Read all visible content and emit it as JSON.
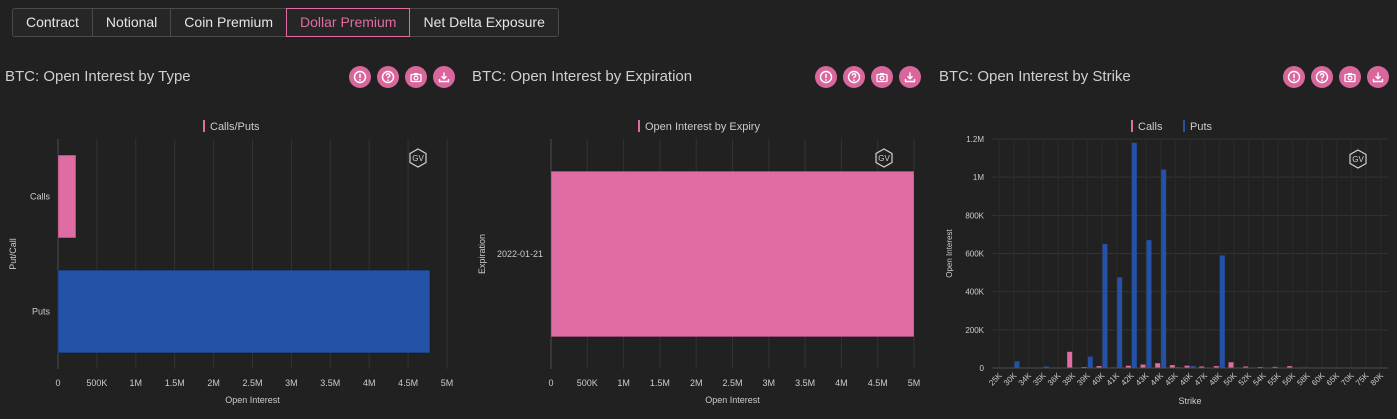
{
  "tabs": [
    {
      "label": "Contract"
    },
    {
      "label": "Notional"
    },
    {
      "label": "Coin Premium"
    },
    {
      "label": "Dollar Premium",
      "active": true
    },
    {
      "label": "Net Delta Exposure"
    }
  ],
  "colors": {
    "calls": "#e06ca4",
    "puts": "#2452a6",
    "accent": "#d9679c",
    "background": "#212121"
  },
  "icons": [
    "info-icon",
    "help-icon",
    "camera-icon",
    "download-icon"
  ],
  "panels": [
    {
      "title": "BTC: Open Interest by Type"
    },
    {
      "title": "BTC: Open Interest by Expiration"
    },
    {
      "title": "BTC: Open Interest by Strike"
    }
  ],
  "watermark": "GV",
  "chart_data": [
    {
      "type": "bar",
      "orientation": "horizontal",
      "legend": [
        "Calls/Puts"
      ],
      "categories": [
        "Calls",
        "Puts"
      ],
      "values": [
        230000,
        4780000
      ],
      "colors": [
        "#e06ca4",
        "#2452a6"
      ],
      "xlabel": "Open Interest",
      "ylabel": "Put/Call",
      "xlim": [
        0,
        5000000
      ],
      "xticks": [
        "0",
        "500K",
        "1M",
        "1.5M",
        "2M",
        "2.5M",
        "3M",
        "3.5M",
        "4M",
        "4.5M",
        "5M"
      ]
    },
    {
      "type": "bar",
      "orientation": "horizontal",
      "legend": [
        "Open Interest by Expiry"
      ],
      "categories": [
        "2022-01-21"
      ],
      "values": [
        5000000
      ],
      "colors": [
        "#e06ca4"
      ],
      "xlabel": "Open Interest",
      "ylabel": "Expiration",
      "xlim": [
        0,
        5000000
      ],
      "xticks": [
        "0",
        "500K",
        "1M",
        "1.5M",
        "2M",
        "2.5M",
        "3M",
        "3.5M",
        "4M",
        "4.5M",
        "5M"
      ]
    },
    {
      "type": "bar",
      "orientation": "vertical",
      "legend": [
        "Calls",
        "Puts"
      ],
      "xlabel": "Strike",
      "ylabel": "Open Interest",
      "ylim": [
        0,
        1200000
      ],
      "yticks": [
        "0",
        "200K",
        "400K",
        "600K",
        "800K",
        "1M",
        "1.2M"
      ],
      "categories": [
        "25K",
        "30K",
        "34K",
        "35K",
        "36K",
        "38K",
        "39K",
        "40K",
        "41K",
        "42K",
        "43K",
        "44K",
        "45K",
        "46K",
        "47K",
        "48K",
        "50K",
        "52K",
        "54K",
        "55K",
        "56K",
        "58K",
        "60K",
        "65K",
        "70K",
        "75K",
        "80K"
      ],
      "series": [
        {
          "name": "Calls",
          "values": [
            0,
            0,
            0,
            0,
            0,
            85000,
            5000,
            10000,
            3000,
            12000,
            18000,
            25000,
            15000,
            12000,
            8000,
            10000,
            30000,
            8000,
            5000,
            6000,
            10000,
            3000,
            2000,
            2000,
            1000,
            0,
            0
          ]
        },
        {
          "name": "Puts",
          "values": [
            0,
            35000,
            0,
            8000,
            0,
            0,
            60000,
            650000,
            475000,
            1180000,
            670000,
            1040000,
            5000,
            10000,
            3000,
            590000,
            0,
            0,
            0,
            0,
            0,
            0,
            0,
            0,
            0,
            0,
            0
          ]
        }
      ]
    }
  ]
}
